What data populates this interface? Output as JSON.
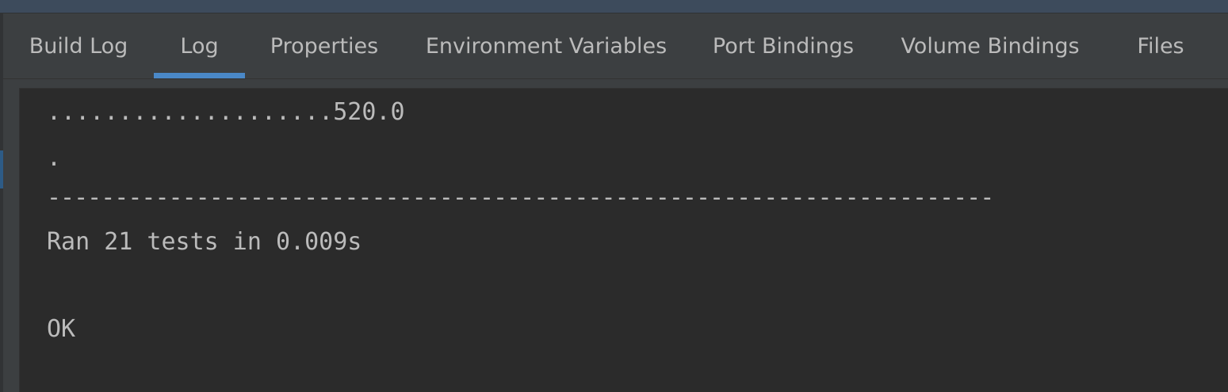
{
  "tabs": [
    {
      "label": "Build Log",
      "active": false
    },
    {
      "label": "Log",
      "active": true
    },
    {
      "label": "Properties",
      "active": false
    },
    {
      "label": "Environment Variables",
      "active": false
    },
    {
      "label": "Port Bindings",
      "active": false
    },
    {
      "label": "Volume Bindings",
      "active": false
    },
    {
      "label": "Files",
      "active": false
    }
  ],
  "console": {
    "lines": [
      "....................520.0",
      ".",
      "----------------------------------------------------------------------",
      "Ran 21 tests in 0.009s",
      "",
      "OK"
    ]
  },
  "colors": {
    "accent": "#4a88c7",
    "tab_text": "#bbbbbb",
    "console_bg": "#2b2b2b",
    "panel_bg": "#3c3f41"
  }
}
